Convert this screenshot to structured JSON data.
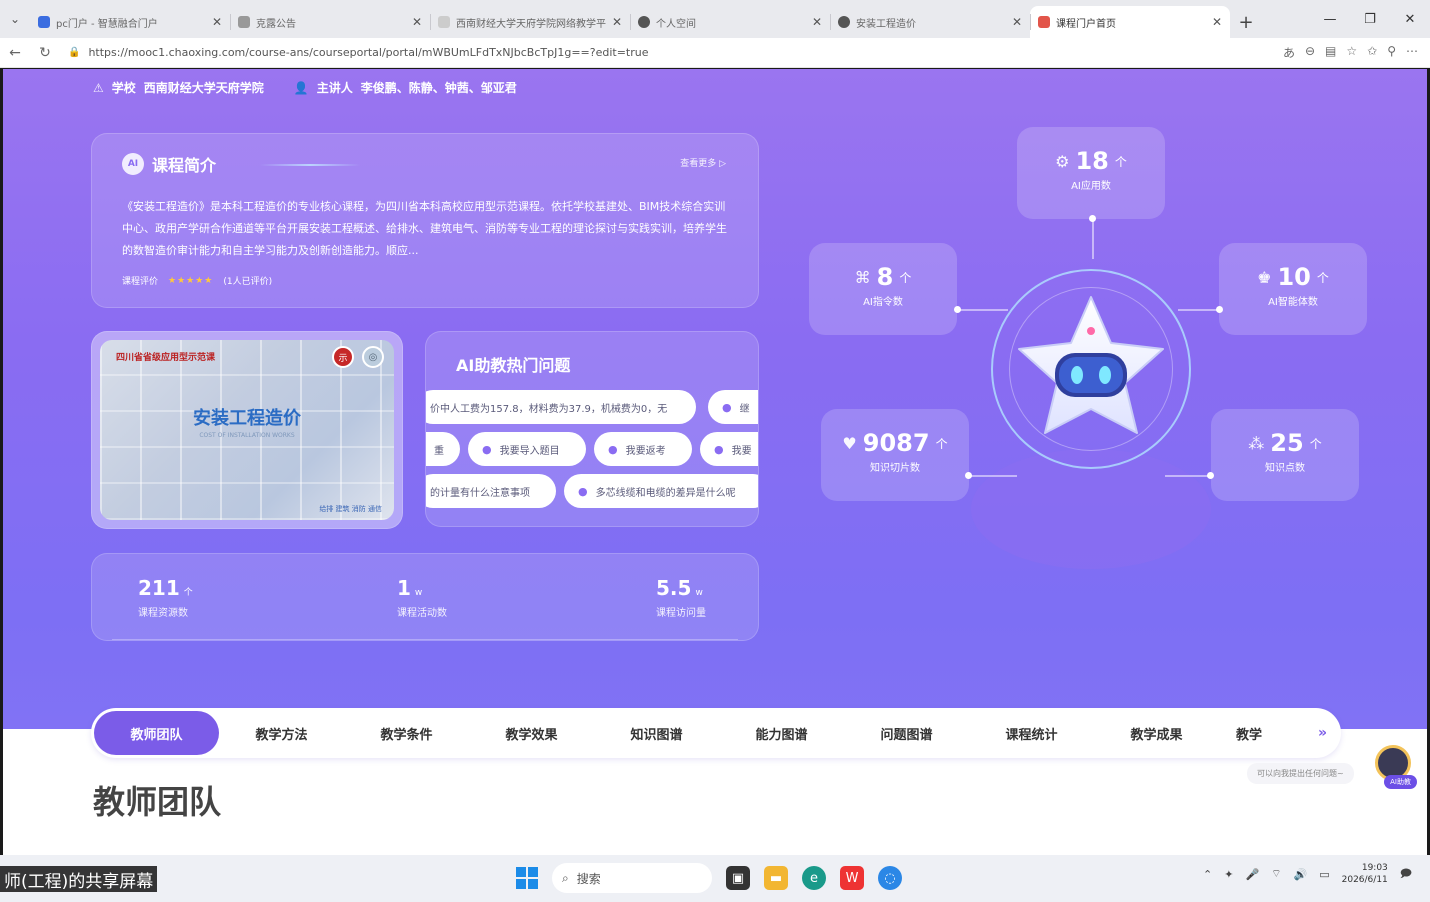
{
  "browser": {
    "tabs": [
      {
        "title": "pc门户 - 智慧融合门户",
        "active": false,
        "fav_color": "#3b6de0"
      },
      {
        "title": "克露公告",
        "active": false,
        "fav_color": "#999999"
      },
      {
        "title": "西南财经大学天府学院网络教学平",
        "active": false,
        "fav_color": "#cccccc"
      },
      {
        "title": "个人空间",
        "active": false,
        "fav_color": "#555555"
      },
      {
        "title": "安装工程造价",
        "active": false,
        "fav_color": "#555555"
      },
      {
        "title": "课程门户首页",
        "active": true,
        "fav_color": "#e2554a"
      }
    ],
    "new_tab": "+",
    "window_controls": {
      "min": "—",
      "max": "❐",
      "close": "✕"
    },
    "url": "https://mooc1.chaoxing.com/course-ans/courseportal/portal/mWBUmLFdTxNJbcBcTpJ1g==?edit=true"
  },
  "page": {
    "school_label": "学校",
    "school_name": "西南财经大学天府学院",
    "lecturer_label": "主讲人",
    "lecturer_names": "李俊鹏、陈静、钟茜、邹亚君",
    "intro": {
      "title": "课程简介",
      "see_more": "查看更多 ▷",
      "text": "《安装工程造价》是本科工程造价的专业核心课程，为四川省本科高校应用型示范课程。依托学校基建处、BIM技术综合实训中心、政用产学研合作通道等平台开展安装工程概述、给排水、建筑电气、消防等专业工程的理论探讨与实践实训，培养学生的数智造价审计能力和自主学习能力及创新创造能力。顺应...",
      "rating_label": "课程评价",
      "stars": "★★★★★",
      "rating_count": "(1人已评价)"
    },
    "cover": {
      "tag": "四川省省级应用型示范课",
      "title": "安装工程造价",
      "subtitle": "COST OF INSTALLATION WORKS",
      "footer": "给排  建筑  消防  通信"
    },
    "hot_questions": {
      "title": "AI助教热门问题",
      "chips": [
        "价中人工费为157.8，材料费为37.9，机械费为0，无",
        "继",
        "重",
        "我要导入题目",
        "我要返考",
        "我要",
        "的计量有什么注意事项",
        "多芯线缆和电缆的差异是什么呢"
      ]
    },
    "stats": [
      {
        "value": "211",
        "unit": "个",
        "label": "课程资源数"
      },
      {
        "value": "1",
        "unit": "w",
        "label": "课程活动数"
      },
      {
        "value": "5.5",
        "unit": "w",
        "label": "课程访问量"
      }
    ],
    "ai_stats": [
      {
        "value": "18",
        "unit": "个",
        "label": "AI应用数",
        "icon": "gear-icon"
      },
      {
        "value": "8",
        "unit": "个",
        "label": "AI指令数",
        "icon": "command-icon"
      },
      {
        "value": "10",
        "unit": "个",
        "label": "AI智能体数",
        "icon": "agent-icon"
      },
      {
        "value": "9087",
        "unit": "个",
        "label": "知识切片数",
        "icon": "heart-icon"
      },
      {
        "value": "25",
        "unit": "个",
        "label": "知识点数",
        "icon": "nodes-icon"
      }
    ],
    "nav_tabs": [
      "教师团队",
      "教学方法",
      "教学条件",
      "教学效果",
      "知识图谱",
      "能力图谱",
      "问题图谱",
      "课程统计",
      "教学成果",
      "教学"
    ],
    "nav_more": "»",
    "section_title": "教师团队",
    "ai_helper_tip": "可以向我提出任何问题~",
    "ai_helper_tag": "AI助教"
  },
  "taskbar": {
    "share_banner": "师(工程)的共享屏幕",
    "search_placeholder": "搜索",
    "time": "19:03",
    "date": "2026/6/11"
  }
}
